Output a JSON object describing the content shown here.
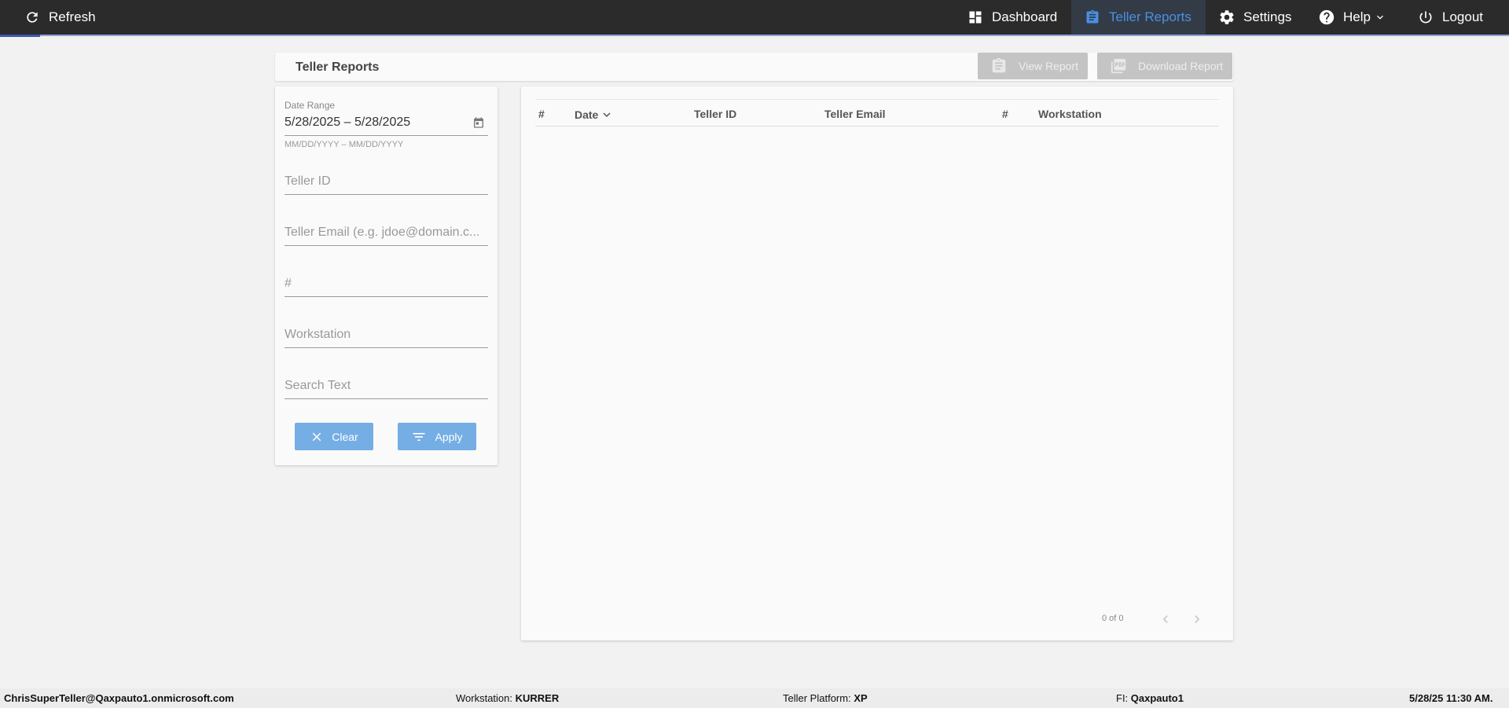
{
  "topbar": {
    "refresh_label": "Refresh",
    "nav": [
      {
        "label": "Dashboard",
        "icon": "dashboard-icon"
      },
      {
        "label": "Teller Reports",
        "icon": "clipboard-icon",
        "active": true
      },
      {
        "label": "Settings",
        "icon": "gear-icon"
      },
      {
        "label": "Help",
        "icon": "help-icon"
      },
      {
        "label": "Logout",
        "icon": "power-icon"
      }
    ],
    "active_color": "#4a90e2"
  },
  "header": {
    "title": "Teller Reports",
    "view_report_label": "View Report",
    "download_report_label": "Download Report"
  },
  "filters": {
    "date_range_label": "Date Range",
    "date_range_value": "5/28/2025 – 5/28/2025",
    "date_range_hint": "MM/DD/YYYY – MM/DD/YYYY",
    "teller_id_placeholder": "Teller ID",
    "teller_email_placeholder": "Teller Email (e.g. jdoe@domain.c...",
    "number_placeholder": "#",
    "workstation_placeholder": "Workstation",
    "search_text_placeholder": "Search Text",
    "clear_label": "Clear",
    "apply_label": "Apply",
    "button_color": "#74aee5"
  },
  "table": {
    "columns": [
      "#",
      "Date",
      "Teller ID",
      "Teller Email",
      "#",
      "Workstation"
    ],
    "rows": [],
    "pager_text": "0 of 0"
  },
  "footer": {
    "user": "ChrisSuperTeller@Qaxpauto1.onmicrosoft.com",
    "workstation_label": "Workstation: ",
    "workstation_value": "KURRER",
    "platform_label": "Teller Platform: ",
    "platform_value": "XP",
    "fi_label": "FI: ",
    "fi_value": "Qaxpauto1",
    "datetime": "5/28/25 11:30 AM."
  }
}
